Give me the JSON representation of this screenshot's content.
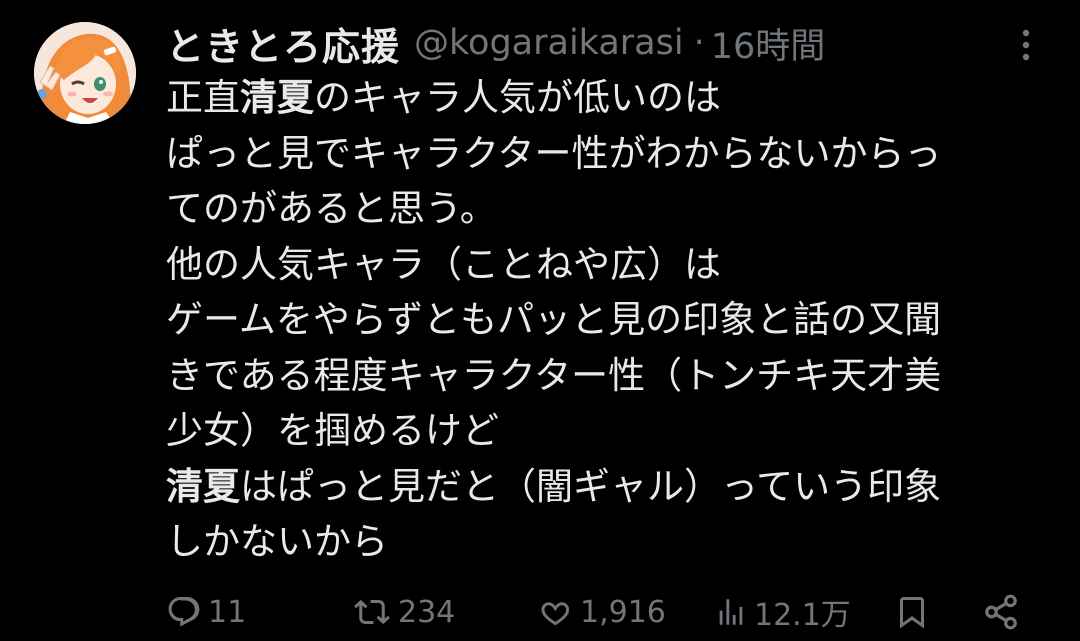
{
  "tweet": {
    "display_name": "ときとろ応援",
    "handle": "@kogaraikarasi",
    "separator": "·",
    "time": "16時間",
    "lines": [
      {
        "pre": "正直",
        "bold": "清夏",
        "post": "のキャラ人気が低いのは"
      },
      {
        "pre": "ぱっと見でキャラクター性がわからないからっ",
        "bold": "",
        "post": ""
      },
      {
        "pre": "てのがあると思う。",
        "bold": "",
        "post": ""
      },
      {
        "pre": "他の人気キャラ（ことねや広）は",
        "bold": "",
        "post": ""
      },
      {
        "pre": "ゲームをやらずともパッと見の印象と話の又聞",
        "bold": "",
        "post": ""
      },
      {
        "pre": "きである程度キャラクター性（トンチキ天才美",
        "bold": "",
        "post": ""
      },
      {
        "pre": "少女）を掴めるけど",
        "bold": "",
        "post": ""
      },
      {
        "pre": "",
        "bold": "清夏",
        "post": "はぱっと見だと（闇ギャル）っていう印象"
      },
      {
        "pre": "しかないから",
        "bold": "",
        "post": ""
      }
    ]
  },
  "actions": {
    "replies": "11",
    "retweets": "234",
    "likes": "1,916",
    "views": "12.1万"
  },
  "icons": {
    "more": "more-vertical-icon",
    "reply": "reply-icon",
    "retweet": "retweet-icon",
    "like": "heart-icon",
    "views": "views-icon",
    "bookmark": "bookmark-icon",
    "share": "share-icon"
  },
  "colors": {
    "background": "#000000",
    "text": "#e7e9ea",
    "secondary": "#71767b",
    "avatar_hair": "#f28a3c"
  }
}
